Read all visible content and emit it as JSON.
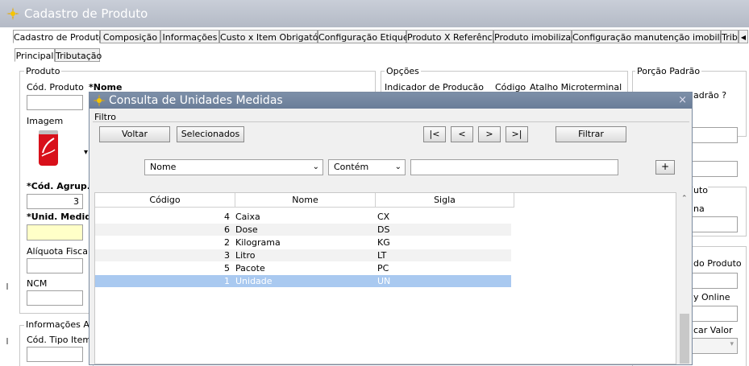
{
  "window": {
    "title": "Cadastro de Produto"
  },
  "tabs": [
    "Cadastro de Produto",
    "Composição",
    "Informações",
    "Custo x Item Obrigatório",
    "Configuração Etiqueta",
    "Produto X Referência",
    "Produto imobilizado",
    "Configuração manutenção imobilizado",
    "Trib"
  ],
  "subtabs": [
    "Principal",
    "Tributação"
  ],
  "produto": {
    "group_label": "Produto",
    "cod_produto": "Cód. Produto",
    "nome": "*Nome",
    "imagem": "Imagem",
    "cod_agrup": "*Cód. Agrup.",
    "cod_agrup_value": "3",
    "unid_medida": "*Unid. Medida",
    "aliquota": "Alíquota Fiscal",
    "ncm": "NCM",
    "info_adic": "Informações Adic",
    "cod_tipo_item": "Cód. Tipo Item"
  },
  "opcoes": {
    "group_label": "Opções",
    "indicador": "Indicador de Producão",
    "codigo": "Código",
    "atalho": "Atalho Microterminal"
  },
  "porcao": {
    "group_label": "Porção Padrão",
    "padrao_q": "adrão ?",
    "uto": "uto",
    "na": "na",
    "do_produto": "do Produto",
    "y_online": "y Online",
    "car_valor": "car Valor"
  },
  "modal": {
    "title": "Consulta de Unidades Medidas",
    "filtro": "Filtro",
    "voltar": "Voltar",
    "selecionados": "Selecionados",
    "nav_first": "|<",
    "nav_prev": "<",
    "nav_next": ">",
    "nav_last": ">|",
    "filtrar": "Filtrar",
    "field_select": "Nome",
    "op_select": "Contém",
    "search_value": "",
    "add": "+",
    "close": "×"
  },
  "grid": {
    "headers": [
      "Código",
      "Nome",
      "Sigla"
    ],
    "rows": [
      {
        "codigo": "4",
        "nome": "Caixa",
        "sigla": "CX"
      },
      {
        "codigo": "6",
        "nome": "Dose",
        "sigla": "DS"
      },
      {
        "codigo": "2",
        "nome": "Kilograma",
        "sigla": "KG"
      },
      {
        "codigo": "3",
        "nome": "Litro",
        "sigla": "LT"
      },
      {
        "codigo": "5",
        "nome": "Pacote",
        "sigla": "PC"
      },
      {
        "codigo": "1",
        "nome": "Unidade",
        "sigla": "UN"
      }
    ],
    "selected_index": 5
  },
  "colors": {
    "titlebar": "#b9bfca",
    "modal_title": "#7386a0",
    "selected_row": "#a9c9f0",
    "required_field": "#ffffc8"
  }
}
